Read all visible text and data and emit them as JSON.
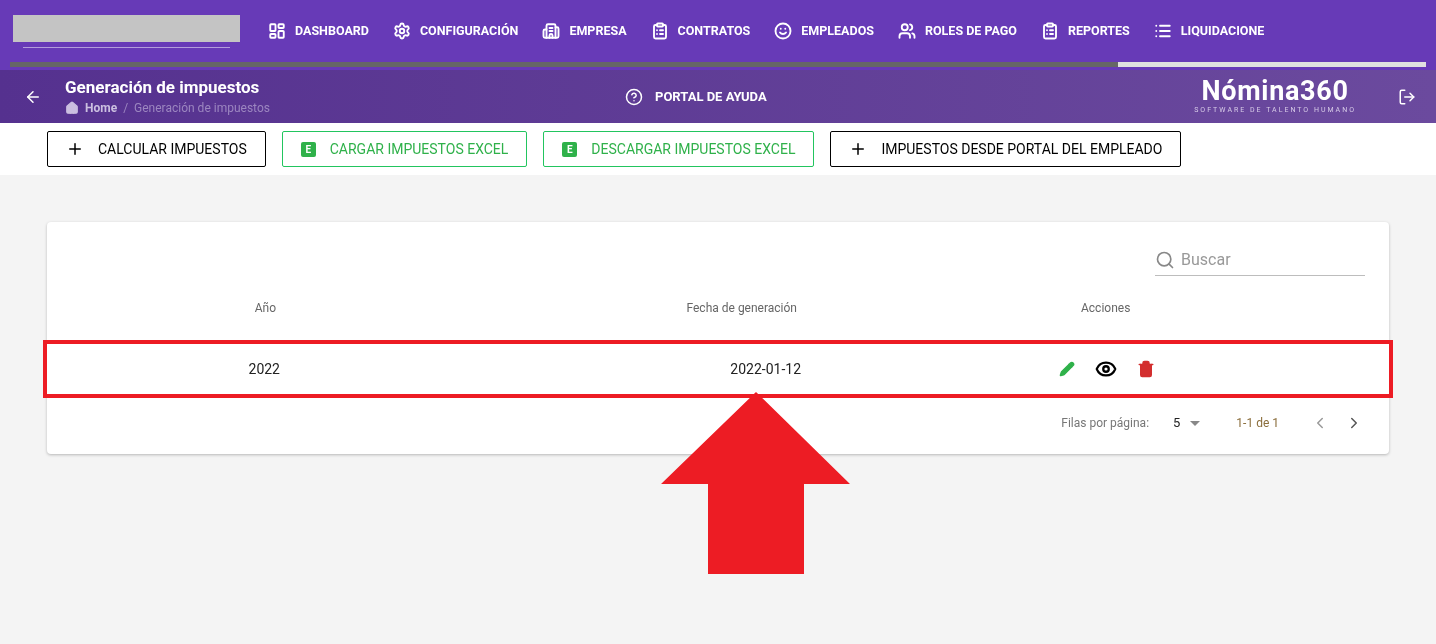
{
  "nav": {
    "items": [
      {
        "label": "DASHBOARD"
      },
      {
        "label": "CONFIGURACIÓN"
      },
      {
        "label": "EMPRESA"
      },
      {
        "label": "CONTRATOS"
      },
      {
        "label": "EMPLEADOS"
      },
      {
        "label": "ROLES DE PAGO"
      },
      {
        "label": "REPORTES"
      },
      {
        "label": "LIQUIDACIONE"
      }
    ]
  },
  "header": {
    "title": "Generación de impuestos",
    "breadcrumb": [
      "Home",
      "Generación de impuestos"
    ],
    "breadcrumb_separator": "/",
    "help": "PORTAL DE AYUDA",
    "logo": {
      "name": "Nómina360",
      "tagline": "SOFTWARE DE TALENTO HUMANO"
    }
  },
  "toolbar": [
    {
      "label": "CALCULAR IMPUESTOS",
      "kind": "add"
    },
    {
      "label": "CARGAR IMPUESTOS EXCEL",
      "kind": "excel",
      "badge": "E"
    },
    {
      "label": "DESCARGAR IMPUESTOS EXCEL",
      "kind": "excel",
      "badge": "E"
    },
    {
      "label": "IMPUESTOS DESDE PORTAL DEL EMPLEADO",
      "kind": "add"
    }
  ],
  "table": {
    "search": {
      "placeholder": "Buscar"
    },
    "columns": [
      "Año",
      "Fecha de generación",
      "Acciones"
    ],
    "rows": [
      {
        "year": "2022",
        "date": "2022-01-12",
        "highlighted": true
      }
    ],
    "pagination": {
      "rows_label": "Filas por página:",
      "rows_value": "5",
      "range": "1-1 de 1"
    }
  }
}
